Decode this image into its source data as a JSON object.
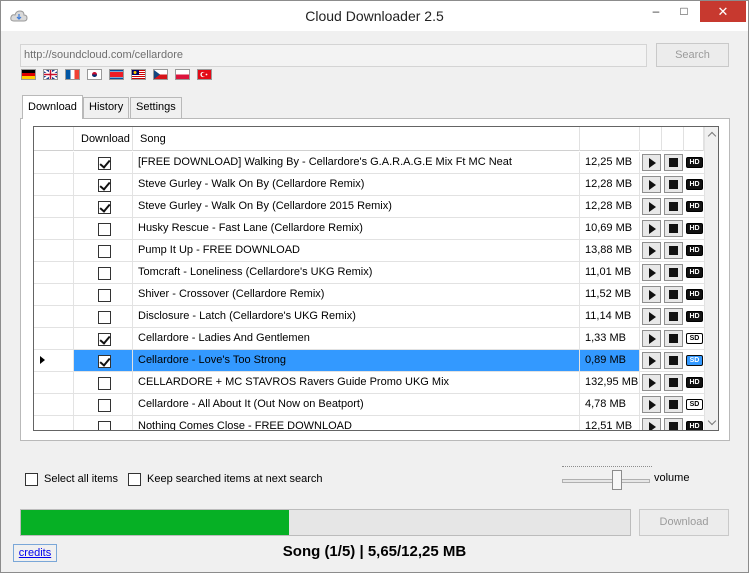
{
  "window": {
    "title": "Cloud Downloader 2.5",
    "minimize": "–",
    "maximize": "□",
    "close": "✕"
  },
  "url": {
    "value": "http://soundcloud.com/cellardore"
  },
  "search": {
    "label": "Search"
  },
  "flags": [
    "de",
    "en",
    "fr",
    "kr",
    "kp",
    "my",
    "cz",
    "pl",
    "tr"
  ],
  "tabs": [
    {
      "label": "Download"
    },
    {
      "label": "History"
    },
    {
      "label": "Settings"
    }
  ],
  "grid": {
    "headers": {
      "download": "Download",
      "song": "Song"
    },
    "rows": [
      {
        "checked": true,
        "song": "[FREE DOWNLOAD] Walking By - Cellardore's G.A.R.A.G.E Mix Ft MC Neat",
        "size": "12,25 MB",
        "quality": "HD"
      },
      {
        "checked": true,
        "song": "Steve Gurley - Walk On By (Cellardore Remix)",
        "size": "12,28 MB",
        "quality": "HD"
      },
      {
        "checked": true,
        "song": "Steve Gurley - Walk On By (Cellardore 2015 Remix)",
        "size": "12,28 MB",
        "quality": "HD"
      },
      {
        "checked": false,
        "song": "Husky Rescue - Fast Lane (Cellardore Remix)",
        "size": "10,69 MB",
        "quality": "HD"
      },
      {
        "checked": false,
        "song": "Pump It Up - FREE DOWNLOAD",
        "size": "13,88 MB",
        "quality": "HD"
      },
      {
        "checked": false,
        "song": "Tomcraft - Loneliness (Cellardore's UKG Remix)",
        "size": "11,01 MB",
        "quality": "HD"
      },
      {
        "checked": false,
        "song": "Shiver - Crossover (Cellardore Remix)",
        "size": "11,52 MB",
        "quality": "HD"
      },
      {
        "checked": false,
        "song": "Disclosure - Latch (Cellardore's UKG Remix)",
        "size": "11,14 MB",
        "quality": "HD"
      },
      {
        "checked": true,
        "song": "Cellardore - Ladies And Gentlemen",
        "size": "1,33 MB",
        "quality": "SD"
      },
      {
        "checked": true,
        "song": "Cellardore - Love's Too Strong",
        "size": "0,89 MB",
        "quality": "SD",
        "selected": true
      },
      {
        "checked": false,
        "song": "CELLARDORE + MC STAVROS Ravers Guide Promo UKG Mix",
        "size": "132,95 MB",
        "quality": "HD"
      },
      {
        "checked": false,
        "song": "Cellardore - All About It (Out Now on Beatport)",
        "size": "4,78 MB",
        "quality": "SD"
      },
      {
        "checked": false,
        "song": "Nothing Comes Close - FREE DOWNLOAD",
        "size": "12,51 MB",
        "quality": "HD"
      }
    ]
  },
  "options": {
    "select_all": "Select all items",
    "keep_searched": "Keep searched items at next search"
  },
  "volume": {
    "label": "volume",
    "level": 0.62
  },
  "progress": {
    "fraction": 0.44
  },
  "download": {
    "label": "Download"
  },
  "credits": {
    "label": "credits"
  },
  "status": {
    "text": "Song (1/5) | 5,65/12,25 MB"
  }
}
